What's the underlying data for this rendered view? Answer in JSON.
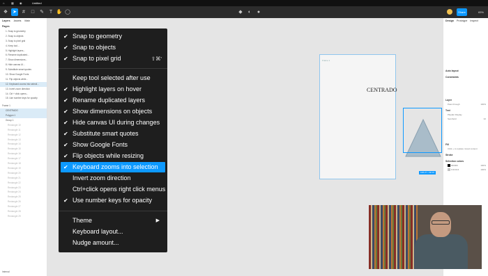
{
  "app": {
    "tab_title": "Untitled",
    "share_label": "Share",
    "zoom_label": "65%"
  },
  "left_panel": {
    "tabs": [
      "Layers",
      "Assets",
      "Main"
    ],
    "pages_label": "Pages",
    "pages": [
      "1. Snap to geometry",
      "2. Snap to objects",
      "3. Snap to pixel grid",
      "4. Keep tool...",
      "5. Highlight layers...",
      "6. Rename duplicated...",
      "7. Show dimensions...",
      "8. Hide canvas UI...",
      "9. Substitute smart quotes",
      "10. Show Google Fonts",
      "11. Flip objects while...",
      "12. Keyboard zooms into selecti...",
      "13. Invert zoom direction",
      "14. Ctrl + click opens...",
      "15. Use number keys for opacity"
    ],
    "layers": [
      "Frame 1",
      "CENTRADO",
      "Polygon 1",
      "Group 1",
      "Rectangle 10",
      "Rectangle 11",
      "Rectangle 12",
      "Rectangle 13",
      "Rectangle 14",
      "Rectangle 15",
      "Rectangle 16",
      "Rectangle 17",
      "Rectangle 18",
      "Rectangle 19",
      "Rectangle 20",
      "Rectangle 21",
      "Rectangle 22",
      "Rectangle 23",
      "Rectangle 24",
      "Rectangle 25",
      "Rectangle 26",
      "Rectangle 27",
      "Rectangle 28",
      "Rectangle 29"
    ],
    "footer": "Internal"
  },
  "canvas": {
    "frame_label": "Frame 1",
    "text": "CENTRADO",
    "dimension_label": "108.27 × 68.15"
  },
  "right_panel": {
    "tabs": [
      "Design",
      "Prototype",
      "Inspect"
    ],
    "sections": [
      "Auto layout",
      "Constraints",
      "Layer",
      "Text",
      "Fill",
      "Stroke",
      "Selection colors"
    ],
    "layer_mode": "Pass through",
    "layer_opacity": "100%",
    "font_name": "Playfair Display",
    "font_style": "Semibold",
    "font_size": "32",
    "fill_hint": "Click + to replace mixed content",
    "colors": [
      {
        "hex": "000000",
        "opacity": "100%"
      },
      {
        "hex": "C4C4C4",
        "opacity": "100%"
      }
    ]
  },
  "menu": {
    "group1": [
      {
        "label": "Snap to geometry",
        "checked": true
      },
      {
        "label": "Snap to objects",
        "checked": true
      },
      {
        "label": "Snap to pixel grid",
        "checked": true,
        "shortcut": "⇧⌘'"
      }
    ],
    "group2": [
      {
        "label": "Keep tool selected after use",
        "checked": false
      },
      {
        "label": "Highlight layers on hover",
        "checked": true
      },
      {
        "label": "Rename duplicated layers",
        "checked": true
      },
      {
        "label": "Show dimensions on objects",
        "checked": true
      },
      {
        "label": "Hide canvas UI during changes",
        "checked": true
      },
      {
        "label": "Substitute smart quotes",
        "checked": true
      },
      {
        "label": "Show Google Fonts",
        "checked": true
      },
      {
        "label": "Flip objects while resizing",
        "checked": true
      },
      {
        "label": "Keyboard zooms into selection",
        "checked": true,
        "highlighted": true
      },
      {
        "label": "Invert zoom direction",
        "checked": false
      },
      {
        "label": "Ctrl+click opens right click menus",
        "checked": false
      },
      {
        "label": "Use number keys for opacity",
        "checked": true
      }
    ],
    "group3": [
      {
        "label": "Theme",
        "submenu": true
      },
      {
        "label": "Keyboard layout..."
      },
      {
        "label": "Nudge amount..."
      }
    ]
  },
  "colors": {
    "accent": "#0d99ff",
    "menu_bg": "#1e1e1e",
    "toolbar_bg": "#2c2c2c"
  }
}
